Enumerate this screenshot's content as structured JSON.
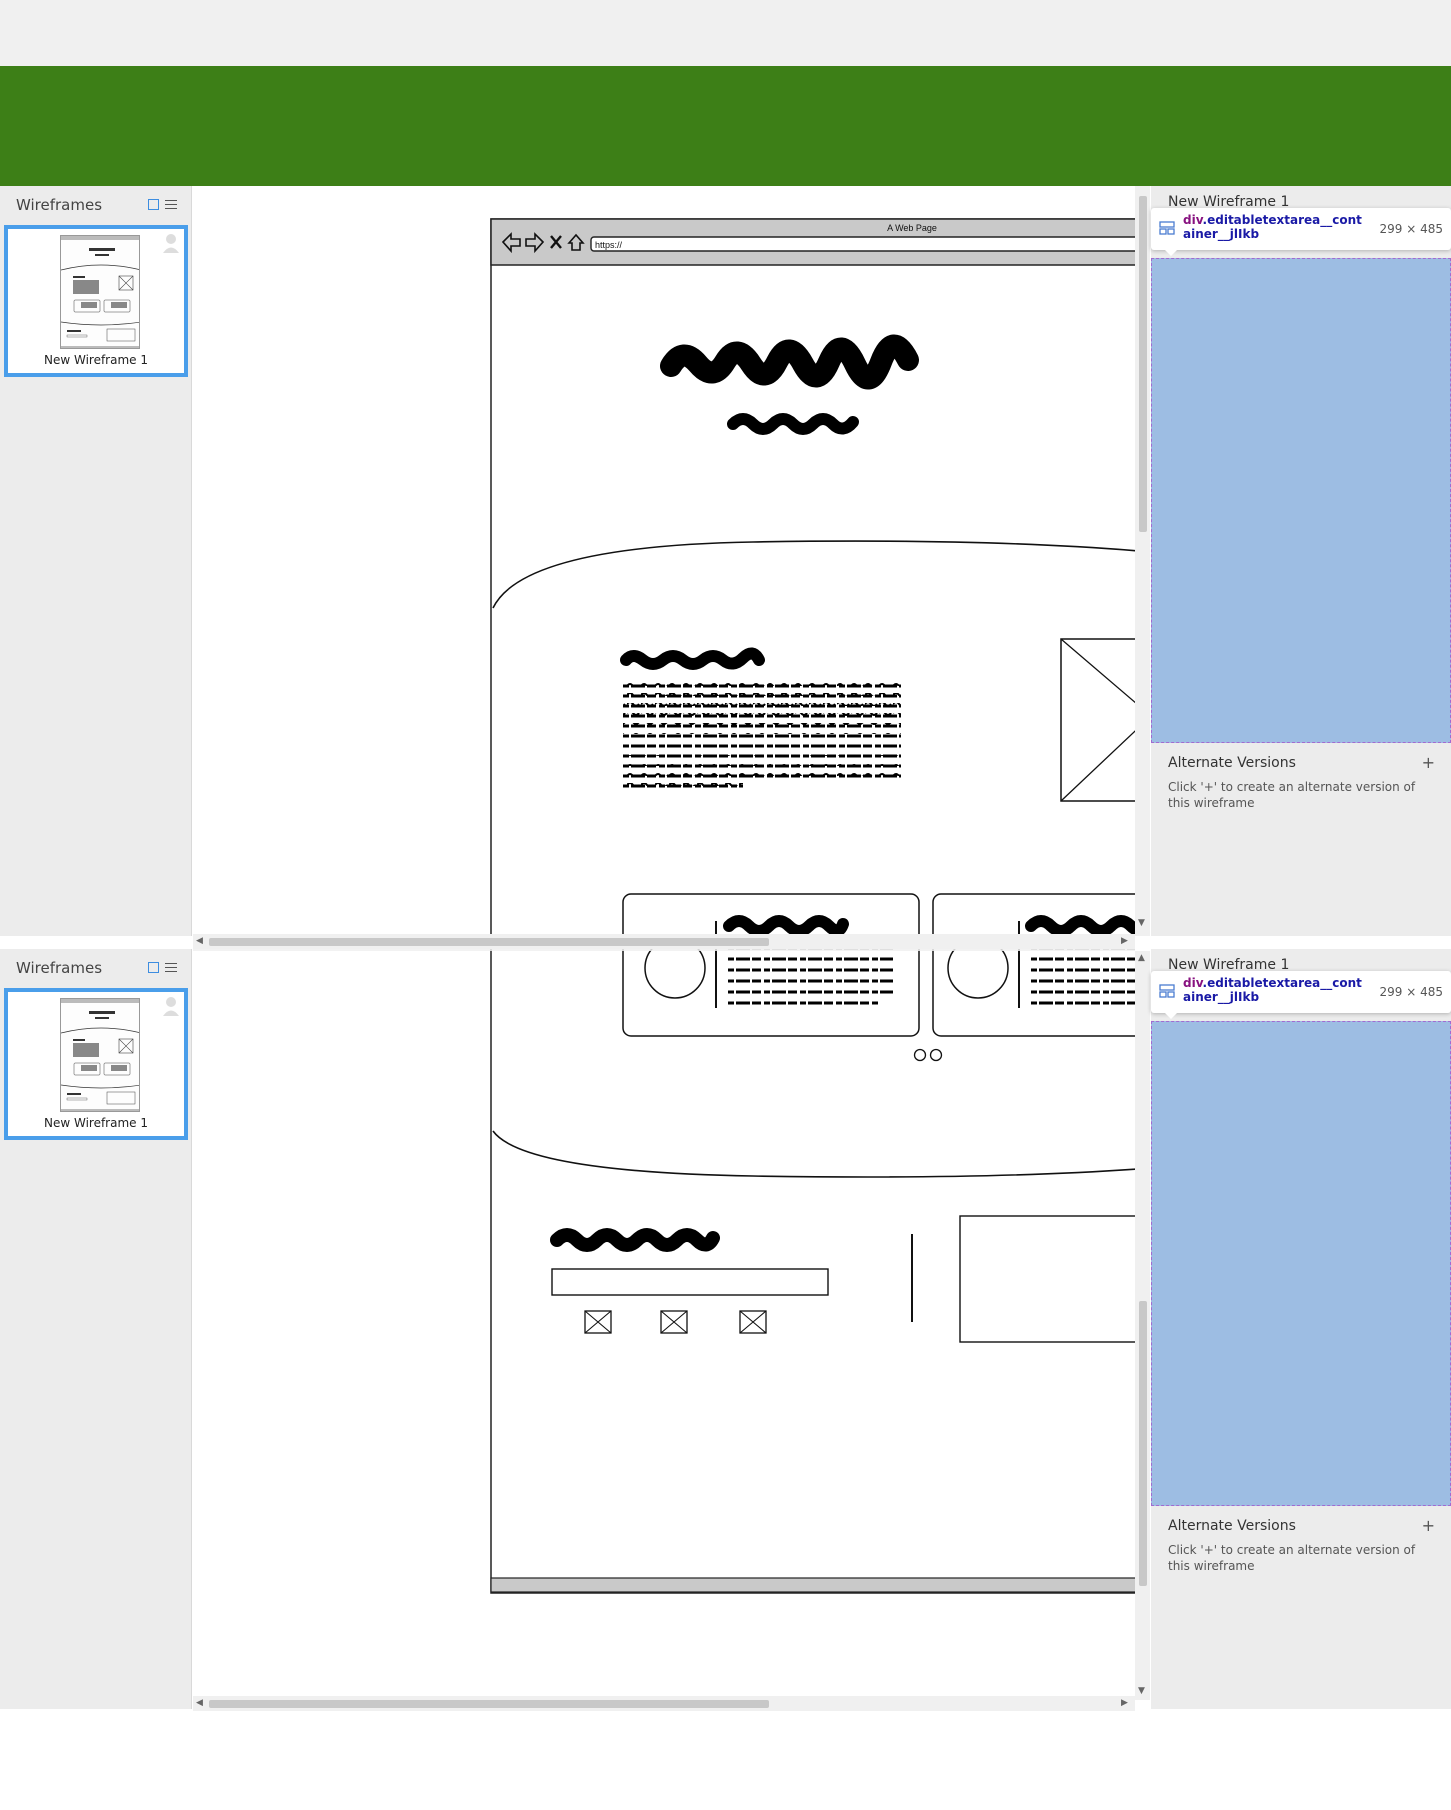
{
  "colors": {
    "brand_green": "#3d7f17",
    "selection_blue": "#4a9eea",
    "highlight_blue": "#9dbde3"
  },
  "sidebar": {
    "header": "Wireframes",
    "view_icons": [
      "grid-view-icon",
      "list-view-icon"
    ],
    "thumbnail_label": "New Wireframe 1"
  },
  "wireframe": {
    "browser_title": "A Web Page",
    "url": "https://",
    "nav_icons": [
      "back-arrow-icon",
      "forward-arrow-icon",
      "close-x-icon",
      "home-icon"
    ],
    "carousel_dots": 2,
    "footer_icon_count": 3
  },
  "right_panel": {
    "title": "New Wireframe 1",
    "inspector_tag": "div",
    "inspector_class": ".editabletextarea__container__jlIkb",
    "inspector_size": "299 × 485",
    "alt_versions_title": "Alternate Versions",
    "alt_versions_add": "+",
    "alt_versions_desc": "Click '+' to create an alternate version of this wireframe"
  }
}
